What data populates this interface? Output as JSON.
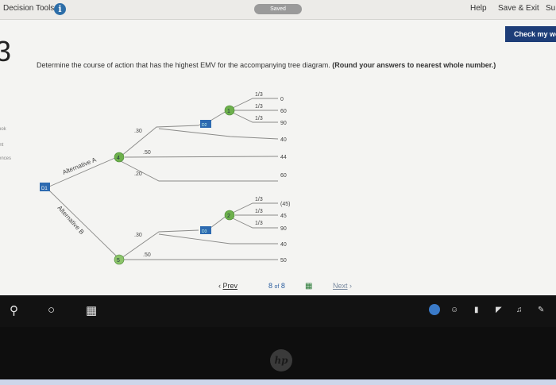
{
  "topbar": {
    "title": "Decision Tools",
    "saved": "Saved",
    "help": "Help",
    "save_exit": "Save & Exit",
    "submit": "Su"
  },
  "check_button": "Check my wo",
  "question_number": "3",
  "sidebar": [
    "ook",
    "int",
    "ences"
  ],
  "question": {
    "text": "Determine the course of action that has the highest EMV for the accompanying tree diagram.",
    "bold": "(Round your answers to nearest whole number.)"
  },
  "tree": {
    "root_label": "D1",
    "alt_a": "Alternative A",
    "alt_b": "Alternative B",
    "node4": "4",
    "node5": "5",
    "node1": "1",
    "node2": "2",
    "d2": "D2",
    "d3": "D3",
    "a_probs": [
      ".30",
      ".50",
      ".20"
    ],
    "a_payoffs": [
      "40",
      "44",
      "60"
    ],
    "d2_probs": [
      "1/3",
      "1/3",
      "1/3"
    ],
    "d2_payoffs": [
      "0",
      "60",
      "90"
    ],
    "b_probs": [
      ".30",
      ".50"
    ],
    "b_payoffs": [
      "40",
      "50"
    ],
    "d3_probs": [
      "1/3",
      "1/3",
      "1/3"
    ],
    "d3_payoffs": [
      "(45)",
      "45",
      "90"
    ]
  },
  "pager": {
    "prev": "Prev",
    "page": "8",
    "of": "of",
    "total": "8",
    "next": "Next"
  },
  "colors": {
    "decision_node": "#2d6ab0",
    "chance_node": "#6db04c",
    "check_button": "#1d3d78"
  }
}
